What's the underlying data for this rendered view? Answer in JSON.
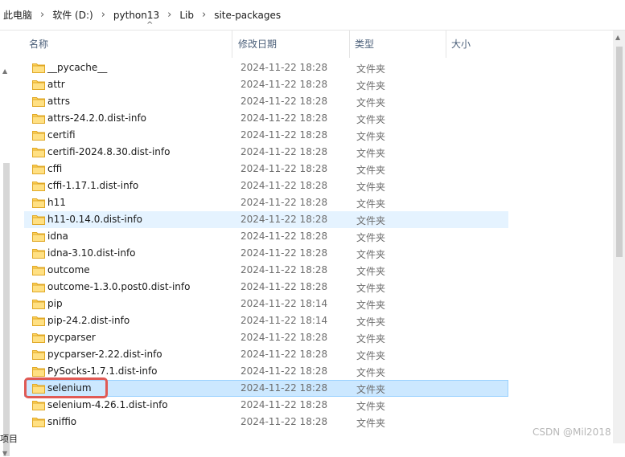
{
  "breadcrumb": {
    "items": [
      "此电脑",
      "软件 (D:)",
      "python13",
      "Lib",
      "site-packages"
    ],
    "separator": "›"
  },
  "columns": {
    "name": "名称",
    "modified": "修改日期",
    "type": "类型",
    "size": "大小",
    "sort_indicator": "^"
  },
  "files": [
    {
      "name": "__pycache__",
      "modified": "2024-11-22 18:28",
      "type": "文件夹"
    },
    {
      "name": "attr",
      "modified": "2024-11-22 18:28",
      "type": "文件夹"
    },
    {
      "name": "attrs",
      "modified": "2024-11-22 18:28",
      "type": "文件夹"
    },
    {
      "name": "attrs-24.2.0.dist-info",
      "modified": "2024-11-22 18:28",
      "type": "文件夹"
    },
    {
      "name": "certifi",
      "modified": "2024-11-22 18:28",
      "type": "文件夹"
    },
    {
      "name": "certifi-2024.8.30.dist-info",
      "modified": "2024-11-22 18:28",
      "type": "文件夹"
    },
    {
      "name": "cffi",
      "modified": "2024-11-22 18:28",
      "type": "文件夹"
    },
    {
      "name": "cffi-1.17.1.dist-info",
      "modified": "2024-11-22 18:28",
      "type": "文件夹"
    },
    {
      "name": "h11",
      "modified": "2024-11-22 18:28",
      "type": "文件夹"
    },
    {
      "name": "h11-0.14.0.dist-info",
      "modified": "2024-11-22 18:28",
      "type": "文件夹"
    },
    {
      "name": "idna",
      "modified": "2024-11-22 18:28",
      "type": "文件夹"
    },
    {
      "name": "idna-3.10.dist-info",
      "modified": "2024-11-22 18:28",
      "type": "文件夹"
    },
    {
      "name": "outcome",
      "modified": "2024-11-22 18:28",
      "type": "文件夹"
    },
    {
      "name": "outcome-1.3.0.post0.dist-info",
      "modified": "2024-11-22 18:28",
      "type": "文件夹"
    },
    {
      "name": "pip",
      "modified": "2024-11-22 18:14",
      "type": "文件夹"
    },
    {
      "name": "pip-24.2.dist-info",
      "modified": "2024-11-22 18:14",
      "type": "文件夹"
    },
    {
      "name": "pycparser",
      "modified": "2024-11-22 18:28",
      "type": "文件夹"
    },
    {
      "name": "pycparser-2.22.dist-info",
      "modified": "2024-11-22 18:28",
      "type": "文件夹"
    },
    {
      "name": "PySocks-1.7.1.dist-info",
      "modified": "2024-11-22 18:28",
      "type": "文件夹"
    },
    {
      "name": "selenium",
      "modified": "2024-11-22 18:28",
      "type": "文件夹"
    },
    {
      "name": "selenium-4.26.1.dist-info",
      "modified": "2024-11-22 18:28",
      "type": "文件夹"
    },
    {
      "name": "sniffio",
      "modified": "2024-11-22 18:28",
      "type": "文件夹"
    }
  ],
  "hover_row": 9,
  "selected_row": 19,
  "status_text": "项目",
  "watermark": "CSDN @Mil2018",
  "colors": {
    "folder": "#ffd35c",
    "selection_bg": "#cce8ff",
    "hover_bg": "#e5f3ff",
    "highlight_border": "#e05a55"
  }
}
